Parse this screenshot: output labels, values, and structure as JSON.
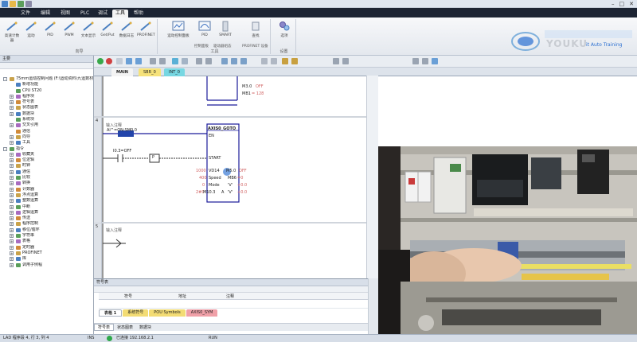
{
  "menu": {
    "tabs": [
      "文件",
      "编辑",
      "视图",
      "PLC",
      "调试",
      "工具",
      "帮助"
    ],
    "active": "工具"
  },
  "ribbon": {
    "group1": {
      "buttons": [
        "高速计数器",
        "运动",
        "PID",
        "PWM",
        "文本显示",
        "Get/Put",
        "数据日志",
        "PROFINET"
      ],
      "name": "向导"
    },
    "group2": {
      "buttons": [
        "运动控制面板",
        "PID",
        "SMART",
        "查找"
      ],
      "sub": [
        "控制面板",
        "驱动器组态",
        "PROFINET 设备"
      ],
      "name": "工具"
    },
    "group3": {
      "buttons": [
        "选项"
      ],
      "name": "设置"
    }
  },
  "logo": {
    "text": "YOUKU",
    "subtext": "it Auto Training"
  },
  "left_panel": {
    "title": "主要",
    "tree": [
      {
        "label": "75mm运动控制问题 (F:\\运动资料\\九运数材",
        "level": 0,
        "exp": "-"
      },
      {
        "label": "新增功能",
        "level": 1,
        "exp": ""
      },
      {
        "label": "CPU ST20",
        "level": 1,
        "exp": ""
      },
      {
        "label": "程序块",
        "level": 1,
        "exp": "+"
      },
      {
        "label": "符号表",
        "level": 1,
        "exp": "+"
      },
      {
        "label": "状态图表",
        "level": 1,
        "exp": "+"
      },
      {
        "label": "数据块",
        "level": 1,
        "exp": "+"
      },
      {
        "label": "系统块",
        "level": 1,
        "exp": ""
      },
      {
        "label": "交叉引用",
        "level": 1,
        "exp": "+"
      },
      {
        "label": "通信",
        "level": 1,
        "exp": ""
      },
      {
        "label": "向导",
        "level": 1,
        "exp": "+"
      },
      {
        "label": "工具",
        "level": 1,
        "exp": "+"
      },
      {
        "label": "指令",
        "level": 0,
        "exp": "-"
      },
      {
        "label": "收藏夹",
        "level": 1,
        "exp": "+"
      },
      {
        "label": "位逻辑",
        "level": 1,
        "exp": "+"
      },
      {
        "label": "时钟",
        "level": 1,
        "exp": "+"
      },
      {
        "label": "通信",
        "level": 1,
        "exp": "+"
      },
      {
        "label": "比较",
        "level": 1,
        "exp": "+"
      },
      {
        "label": "转换",
        "level": 1,
        "exp": "+"
      },
      {
        "label": "计数器",
        "level": 1,
        "exp": "+"
      },
      {
        "label": "浮点运算",
        "level": 1,
        "exp": "+"
      },
      {
        "label": "整数运算",
        "level": 1,
        "exp": "+"
      },
      {
        "label": "中断",
        "level": 1,
        "exp": "+"
      },
      {
        "label": "逻辑运算",
        "level": 1,
        "exp": "+"
      },
      {
        "label": "传送",
        "level": 1,
        "exp": "+"
      },
      {
        "label": "程序控制",
        "level": 1,
        "exp": "+"
      },
      {
        "label": "移位/循环",
        "level": 1,
        "exp": "+"
      },
      {
        "label": "字符串",
        "level": 1,
        "exp": "+"
      },
      {
        "label": "表格",
        "level": 1,
        "exp": "+"
      },
      {
        "label": "定时器",
        "level": 1,
        "exp": "+"
      },
      {
        "label": "PROFINET",
        "level": 1,
        "exp": "+"
      },
      {
        "label": "库",
        "level": 1,
        "exp": "+"
      },
      {
        "label": "调用子例程",
        "level": 1,
        "exp": "+"
      }
    ]
  },
  "editor": {
    "tabs": [
      {
        "label": "MAIN",
        "color": "#e9e9e9"
      },
      {
        "label": "SBR_0",
        "color": "#f6e27a"
      },
      {
        "label": "INT_0",
        "color": "#77d7e2"
      }
    ],
    "net3": {
      "m30": "M3.0",
      "m30val": "OFF",
      "mb1": "MB1",
      "mb1val": "= 128"
    },
    "net4": {
      "num": "4",
      "comment": "输入注释",
      "contact1": "Al^=ON:SM0.0",
      "contact2": "I0.3=OFF",
      "p": "P",
      "block": "AXIS0_GOTO",
      "en": "EN",
      "start": "START",
      "pos_in": "1000",
      "pos_var": "VD14",
      "pos_label": "Pos",
      "speed_in": "400",
      "speed_label": "Speed",
      "mode_in": "0",
      "mode_label": "Mode",
      "abort_in": "2#0",
      "abort_var": "M10.3",
      "abort_label": "A",
      "done_var": "M5.0",
      "done_val": "OFF",
      "error_var": "MB6",
      "error_val": "=0",
      "cpos": "'V'",
      "cpos_val": "+0.0",
      "cspeed": "'V'",
      "cspeed_val": "+0.0"
    },
    "net5": {
      "num": "5",
      "comment": "输入注释"
    }
  },
  "symbol_panel": {
    "title": "符号表",
    "col_symbol": "符号",
    "col_address": "地址",
    "col_comment": "注释",
    "tabs": [
      {
        "label": "表格 1",
        "color": "#ffffff"
      },
      {
        "label": "系统符号",
        "color": "#f3dc74"
      },
      {
        "label": "POU Symbols",
        "color": "#f3dc74"
      },
      {
        "label": "AXIS0_SYM",
        "color": "#f0a0a8"
      }
    ],
    "bottom_tabs": [
      "符号表",
      "状态图表",
      "数据块"
    ]
  },
  "statusbar": {
    "mode": "LAD 程序段 4, 行 3, 列 4",
    "ins": "INS",
    "connected": "已连接 192.168.2.1",
    "run": "RUN"
  },
  "colors": {
    "menubar": "#1c2433",
    "accent": "#2a6fd1",
    "green_status": "#2ea84a"
  }
}
